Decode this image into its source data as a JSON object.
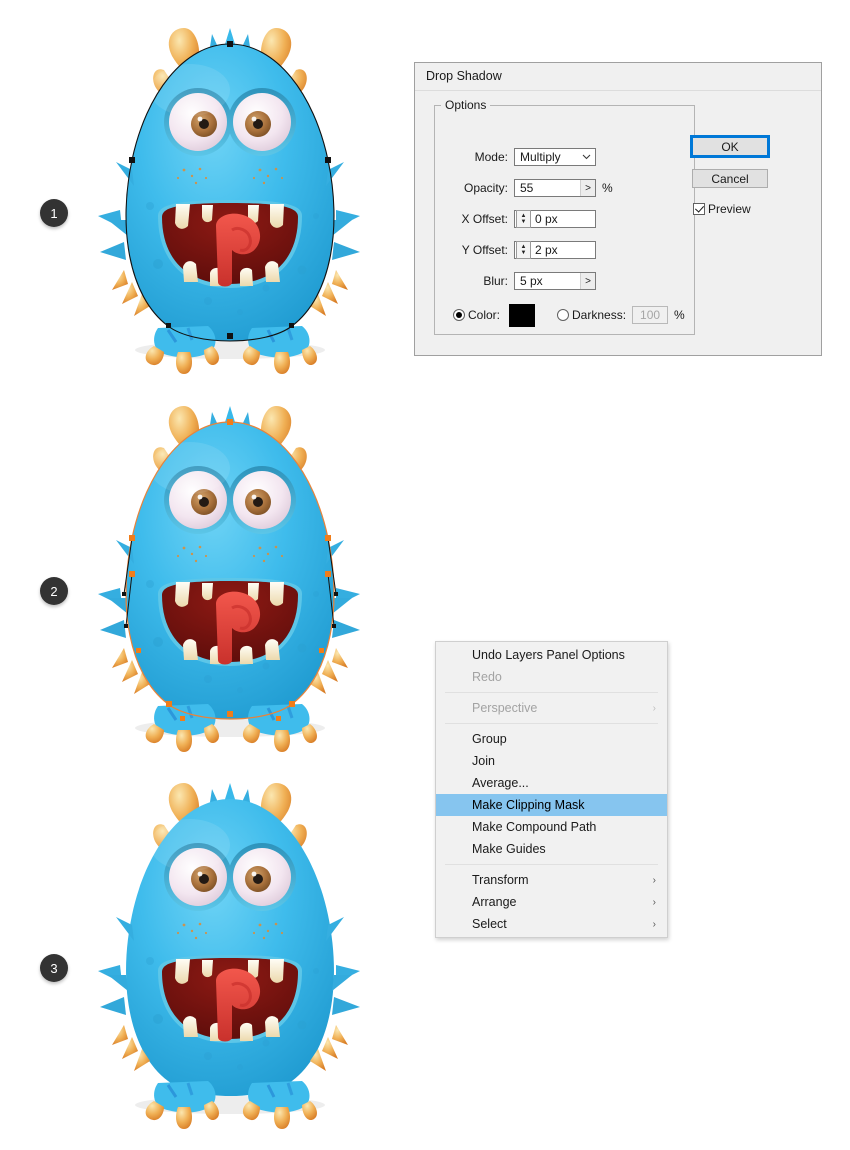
{
  "steps": [
    {
      "number": "1"
    },
    {
      "number": "2"
    },
    {
      "number": "3"
    }
  ],
  "dialog": {
    "title": "Drop Shadow",
    "group_legend": "Options",
    "fields": {
      "mode_label": "Mode:",
      "mode_value": "Multiply",
      "opacity_label": "Opacity:",
      "opacity_value": "55",
      "opacity_unit": "%",
      "xoffset_label": "X Offset:",
      "xoffset_value": "0 px",
      "yoffset_label": "Y Offset:",
      "yoffset_value": "2 px",
      "blur_label": "Blur:",
      "blur_value": "5 px",
      "color_label": "Color:",
      "color_swatch": "#000000",
      "darkness_label": "Darkness:",
      "darkness_value": "100",
      "darkness_unit": "%"
    },
    "buttons": {
      "ok": "OK",
      "cancel": "Cancel",
      "preview": "Preview"
    },
    "accent_color": "#0078d7",
    "slider_glyph": ">",
    "combo_glyph": "⌄"
  },
  "context_menu": {
    "items": [
      {
        "label": "Undo Layers Panel Options",
        "disabled": false,
        "selected": false,
        "submenu": false
      },
      {
        "label": "Redo",
        "disabled": true,
        "selected": false,
        "submenu": false
      },
      {
        "separator": true
      },
      {
        "label": "Perspective",
        "disabled": true,
        "selected": false,
        "submenu": true
      },
      {
        "separator": true
      },
      {
        "label": "Group",
        "disabled": false,
        "selected": false,
        "submenu": false
      },
      {
        "label": "Join",
        "disabled": false,
        "selected": false,
        "submenu": false
      },
      {
        "label": "Average...",
        "disabled": false,
        "selected": false,
        "submenu": false
      },
      {
        "label": "Make Clipping Mask",
        "disabled": false,
        "selected": true,
        "submenu": false
      },
      {
        "label": "Make Compound Path",
        "disabled": false,
        "selected": false,
        "submenu": false
      },
      {
        "label": "Make Guides",
        "disabled": false,
        "selected": false,
        "submenu": false
      },
      {
        "separator": true
      },
      {
        "label": "Transform",
        "disabled": false,
        "selected": false,
        "submenu": true
      },
      {
        "label": "Arrange",
        "disabled": false,
        "selected": false,
        "submenu": true
      },
      {
        "label": "Select",
        "disabled": false,
        "selected": false,
        "submenu": true
      }
    ],
    "submenu_glyph": "›",
    "highlight_color": "#86c5ef"
  },
  "artwork": {
    "subject": "blue furry cartoon monster",
    "colors": {
      "body_light": "#4fc6ef",
      "body_mid": "#31b4e6",
      "body_dark": "#1f9ad0",
      "spot": "#2a9fd0",
      "horn_light": "#f7d98f",
      "horn_mid": "#f0ae52",
      "horn_dark": "#e08b33",
      "eye_white": "#f2e4ee",
      "eye_ring": "#3aa9cf",
      "iris": "#a9713c",
      "iris_light": "#c99a63",
      "pupil": "#231a14",
      "mouth": "#7e1410",
      "mouth_dark": "#5e0d0b",
      "tongue": "#e8453c",
      "tongue_dark": "#c9312c",
      "tooth": "#f7ecd0",
      "path_stroke": "#111111",
      "selected_path": "#e8833a",
      "anchor_selected": "#f07d1a"
    },
    "variants": [
      {
        "path_overlay": "black-outline",
        "label_number": "1"
      },
      {
        "path_overlay": "orange-selected",
        "label_number": "2"
      },
      {
        "path_overlay": "none",
        "label_number": "3"
      }
    ]
  }
}
